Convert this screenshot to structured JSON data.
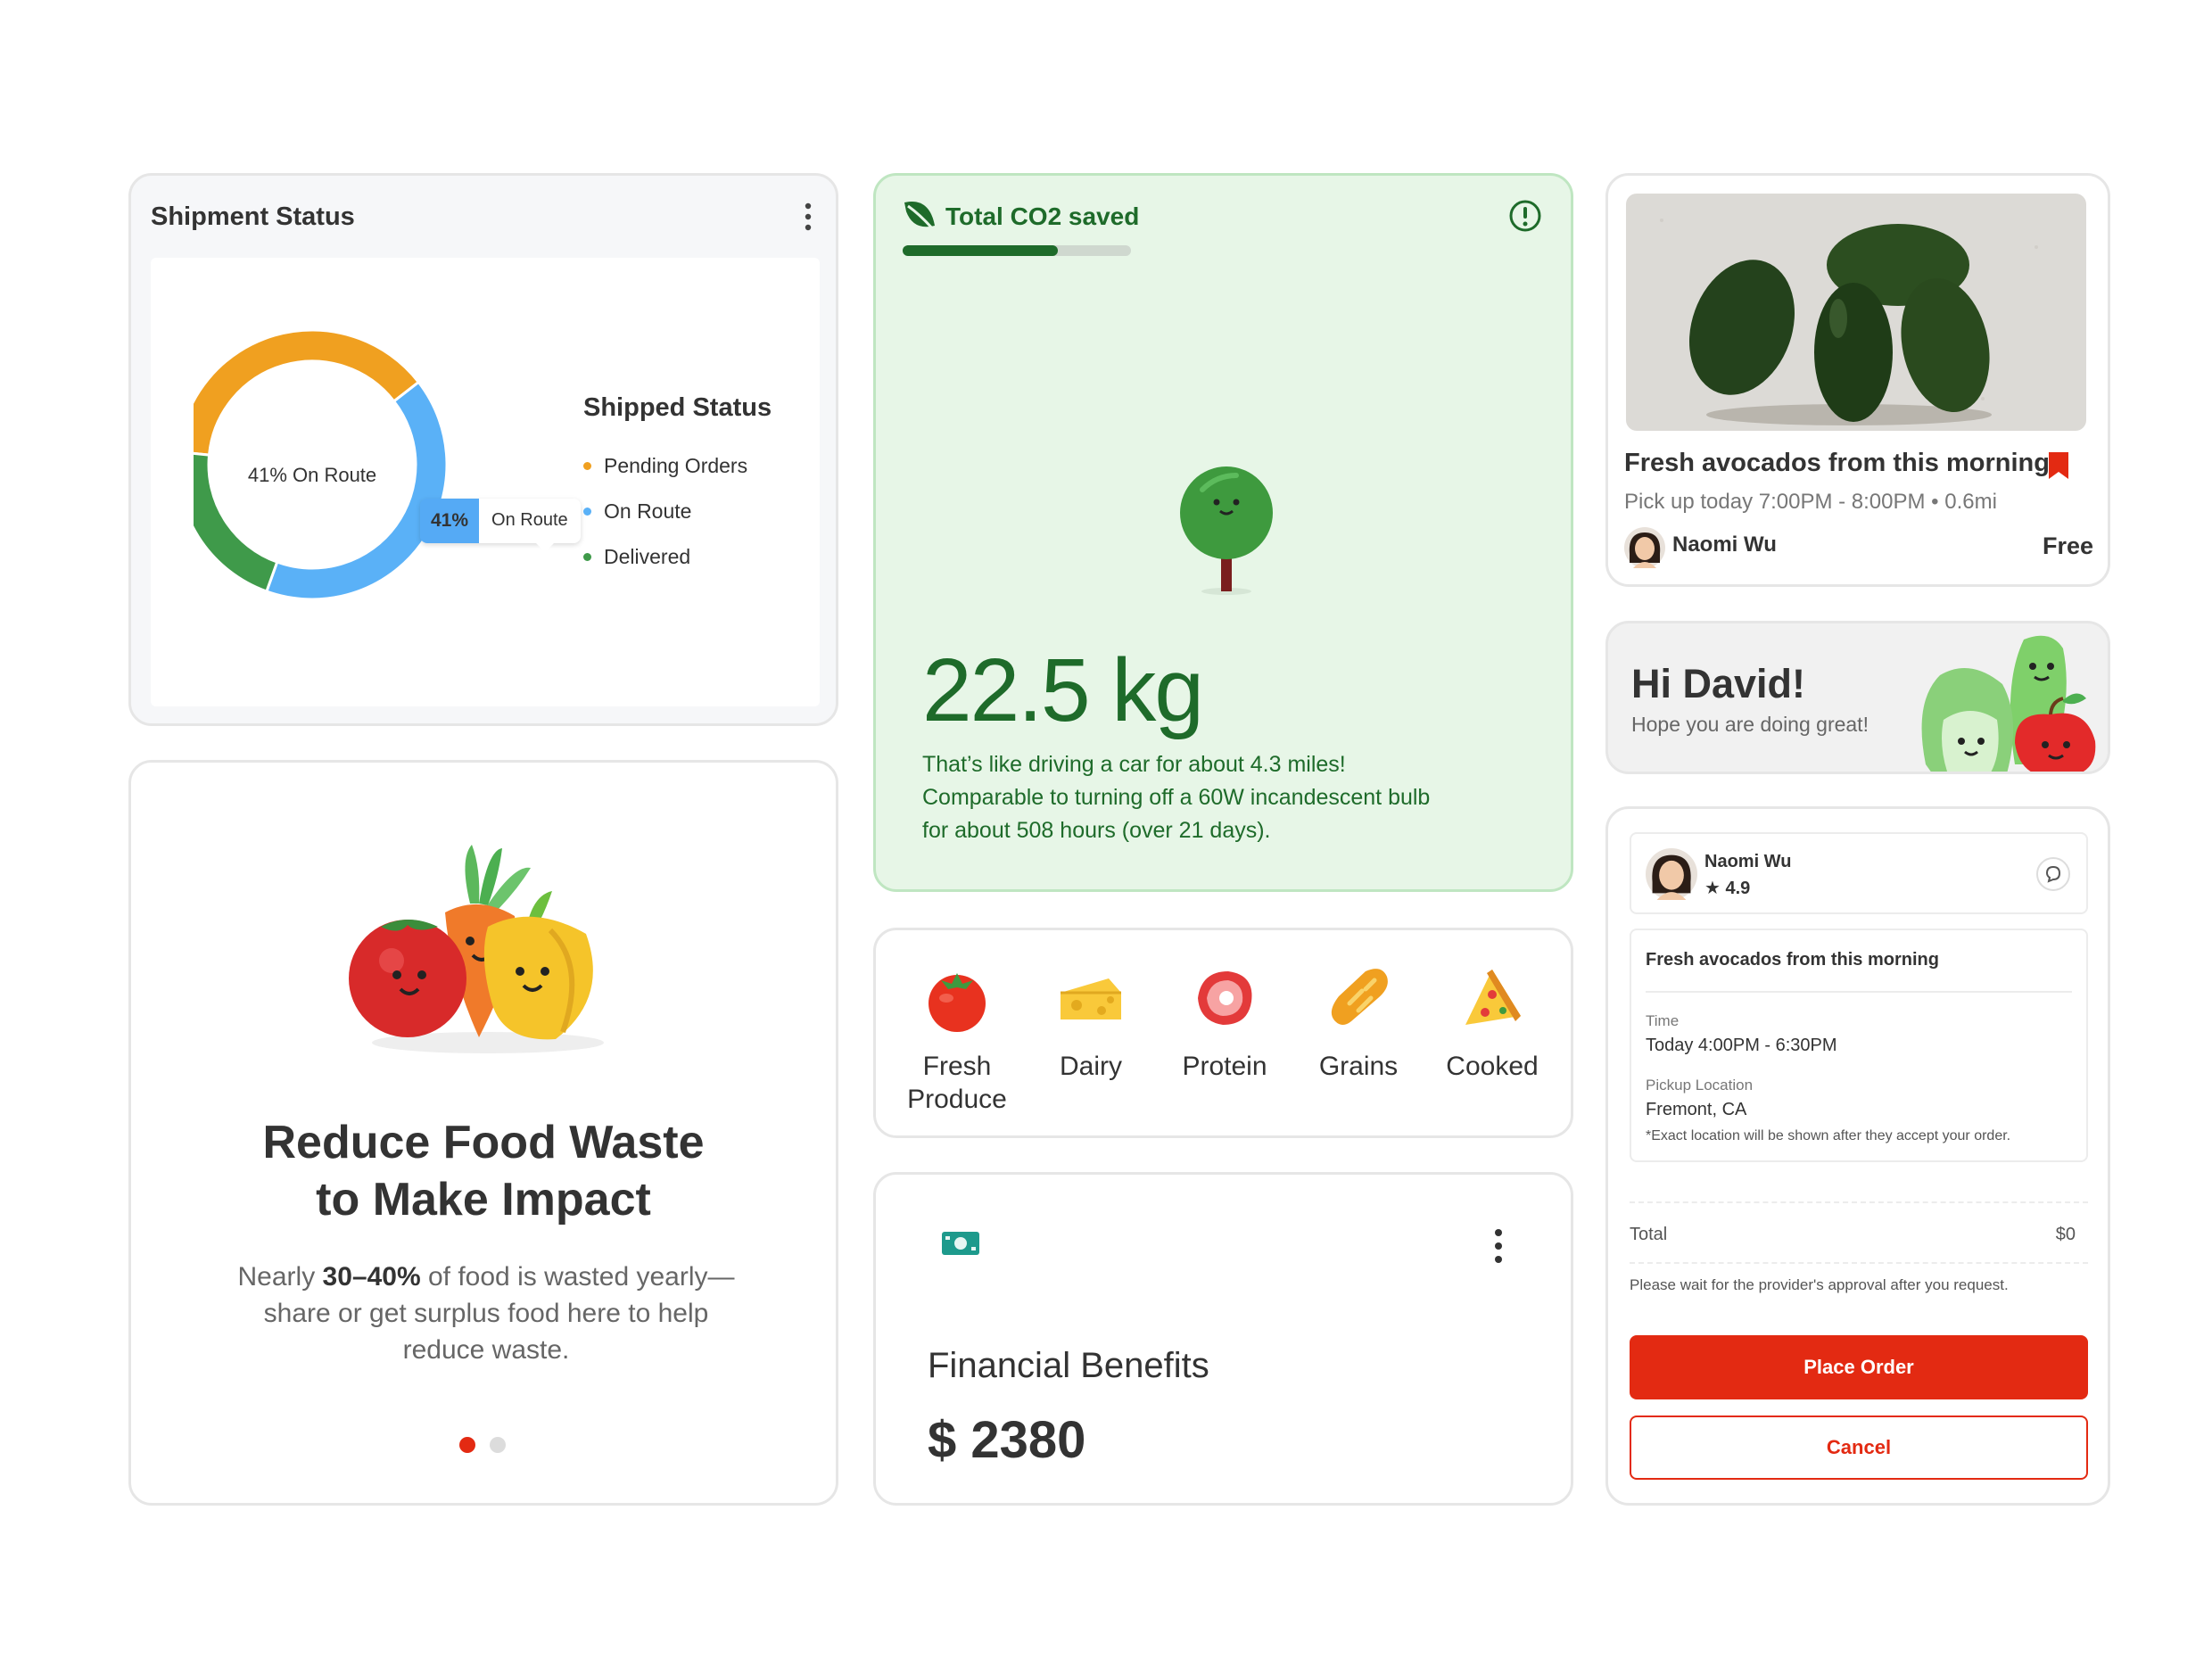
{
  "shipment": {
    "title": "Shipment Status",
    "center_label": "41% On Route",
    "legend_title": "Shipped Status",
    "tooltip": {
      "percent": "41%",
      "label": "On Route"
    },
    "chart_data": {
      "type": "pie",
      "title": "Shipped Status",
      "categories": [
        "Pending Orders",
        "On Route",
        "Delivered"
      ],
      "values": [
        38,
        41,
        21
      ],
      "colors": [
        "#f0a020",
        "#5ab1f7",
        "#3f9a4a"
      ]
    }
  },
  "co2": {
    "title": "Total CO2 saved",
    "progress": 0.68,
    "value": "22.5 kg",
    "description_lines": [
      "That’s like driving a car for about 4.3 miles!",
      "Comparable to turning off a 60W incandescent bulb",
      "for about 508 hours (over 21 days)."
    ]
  },
  "categories": [
    {
      "label": "Fresh Produce",
      "icon": "tomato-icon"
    },
    {
      "label": "Dairy",
      "icon": "cheese-icon"
    },
    {
      "label": "Protein",
      "icon": "meat-icon"
    },
    {
      "label": "Grains",
      "icon": "bread-icon"
    },
    {
      "label": "Cooked",
      "icon": "pizza-icon"
    }
  ],
  "financial": {
    "label": "Financial Benefits",
    "amount": "$ 2380"
  },
  "reduce": {
    "headline_line1": "Reduce Food Waste",
    "headline_line2": "to Make Impact",
    "body_pre": "Nearly ",
    "body_bold": "30–40%",
    "body_post": " of food is wasted yearly—share or get surplus food here to help reduce waste.",
    "active_slide": 1,
    "slide_count": 2
  },
  "listing": {
    "title": "Fresh avocados from this morning",
    "pickup": "Pick up today 7:00PM - 8:00PM • 0.6mi",
    "seller": "Naomi Wu",
    "price": "Free"
  },
  "greeting": {
    "title": "Hi David!",
    "subtitle": "Hope you are doing great!"
  },
  "order": {
    "provider_name": "Naomi Wu",
    "rating": "★ 4.9",
    "item_title": "Fresh avocados from this morning",
    "time_label": "Time",
    "time_value": "Today 4:00PM - 6:30PM",
    "location_label": "Pickup Location",
    "location_value": "Fremont, CA",
    "location_note": "*Exact location will be shown after they accept your order.",
    "total_label": "Total",
    "total_value": "$0",
    "wait_note": "Please wait for the provider's approval after you request.",
    "place_order_label": "Place Order",
    "cancel_label": "Cancel"
  },
  "colors": {
    "accent_red": "#e32a12",
    "co2_green": "#1e6b2a",
    "co2_bg": "#e7f6e7"
  }
}
